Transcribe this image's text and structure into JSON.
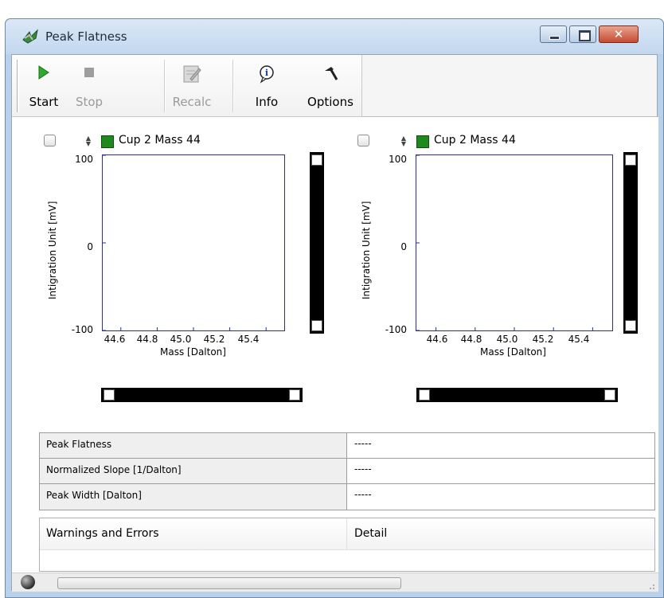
{
  "window": {
    "title": "Peak Flatness",
    "close_label": "✕"
  },
  "toolbar": {
    "buttons": [
      {
        "label": "Start",
        "icon": "play-icon",
        "enabled": true
      },
      {
        "label": "Stop",
        "icon": "stop-icon",
        "enabled": false
      },
      {
        "label": "Recalc",
        "icon": "recalc-icon",
        "enabled": false
      },
      {
        "label": "Info",
        "icon": "info-icon",
        "enabled": true
      },
      {
        "label": "Options",
        "icon": "hammer-icon",
        "enabled": true
      }
    ]
  },
  "charts": [
    {
      "channel_label": "Cup 2 Mass 44",
      "channel_color": "#1e8a1e",
      "checked": false,
      "y_ticks": [
        "100",
        "0",
        "-100"
      ],
      "x_ticks": [
        "44.6",
        "44.8",
        "45.0",
        "45.2",
        "45.4"
      ]
    },
    {
      "channel_label": "Cup 2 Mass 44",
      "channel_color": "#1e8a1e",
      "checked": false,
      "y_ticks": [
        "100",
        "0",
        "-100"
      ],
      "x_ticks": [
        "44.6",
        "44.8",
        "45.0",
        "45.2",
        "45.4"
      ]
    }
  ],
  "chart_data": [
    {
      "type": "line",
      "title": "Cup 2 Mass 44",
      "xlabel": "Mass [Dalton]",
      "ylabel": "Intigration Unit [mV]",
      "xlim": [
        44.5,
        45.5
      ],
      "ylim": [
        -100,
        100
      ],
      "series": []
    },
    {
      "type": "line",
      "title": "Cup 2 Mass 44",
      "xlabel": "Mass [Dalton]",
      "ylabel": "Intigration Unit [mV]",
      "xlim": [
        44.5,
        45.5
      ],
      "ylim": [
        -100,
        100
      ],
      "series": []
    }
  ],
  "results": {
    "rows": [
      {
        "label": "Peak Flatness",
        "value": "-----"
      },
      {
        "label": "Normalized Slope [1/Dalton]",
        "value": "-----"
      },
      {
        "label": "Peak Width [Dalton]",
        "value": "-----"
      }
    ]
  },
  "warnings": {
    "col1": "Warnings and Errors",
    "col2": "Detail"
  },
  "statusbar": {
    "progress": 0
  }
}
